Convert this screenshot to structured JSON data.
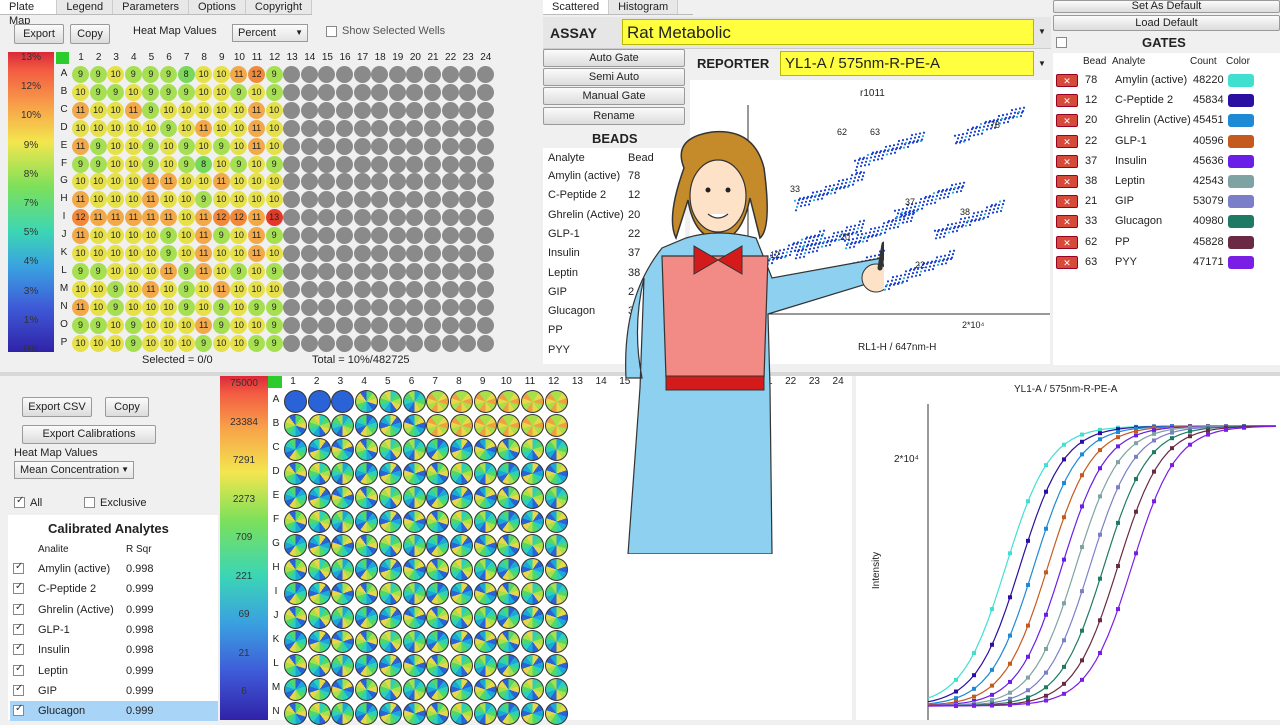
{
  "left_tabs": [
    "Plate Map",
    "Legend",
    "Parameters",
    "Options",
    "Copyright"
  ],
  "plate": {
    "export_label": "Export",
    "copy_label": "Copy",
    "heat_label": "Heat Map Values",
    "heat_value": "Percent",
    "show_selected_label": "Show Selected Wells",
    "scale": [
      "13%",
      "12%",
      "10%",
      "9%",
      "8%",
      "7%",
      "5%",
      "4%",
      "3%",
      "1%",
      "0%"
    ],
    "columns": [
      "1",
      "2",
      "3",
      "4",
      "5",
      "6",
      "7",
      "8",
      "9",
      "10",
      "11",
      "12",
      "13",
      "14",
      "15",
      "16",
      "17",
      "18",
      "19",
      "20",
      "21",
      "22",
      "23",
      "24"
    ],
    "rows": [
      "A",
      "B",
      "C",
      "D",
      "E",
      "F",
      "G",
      "H",
      "I",
      "J",
      "K",
      "L",
      "M",
      "N",
      "O",
      "P"
    ],
    "values": [
      [
        "9",
        "9",
        "10",
        "9",
        "9",
        "9",
        "8",
        "10",
        "10",
        "11",
        "12",
        "9"
      ],
      [
        "10",
        "9",
        "9",
        "10",
        "9",
        "9",
        "9",
        "10",
        "10",
        "9",
        "10",
        "9"
      ],
      [
        "11",
        "10",
        "10",
        "11",
        "9",
        "10",
        "10",
        "10",
        "10",
        "10",
        "11",
        "10"
      ],
      [
        "10",
        "10",
        "10",
        "10",
        "10",
        "9",
        "10",
        "11",
        "10",
        "10",
        "11",
        "10"
      ],
      [
        "11",
        "9",
        "10",
        "10",
        "9",
        "10",
        "9",
        "10",
        "9",
        "10",
        "11",
        "10"
      ],
      [
        "9",
        "9",
        "10",
        "10",
        "9",
        "10",
        "9",
        "8",
        "10",
        "9",
        "10",
        "9"
      ],
      [
        "10",
        "10",
        "10",
        "10",
        "11",
        "11",
        "10",
        "10",
        "11",
        "10",
        "10",
        "10"
      ],
      [
        "11",
        "10",
        "10",
        "10",
        "11",
        "10",
        "10",
        "9",
        "10",
        "10",
        "10",
        "10"
      ],
      [
        "12",
        "11",
        "11",
        "11",
        "11",
        "11",
        "10",
        "11",
        "12",
        "12",
        "11",
        "13"
      ],
      [
        "11",
        "10",
        "10",
        "10",
        "10",
        "9",
        "10",
        "11",
        "9",
        "10",
        "11",
        "9"
      ],
      [
        "10",
        "10",
        "10",
        "10",
        "10",
        "9",
        "10",
        "11",
        "10",
        "10",
        "11",
        "10"
      ],
      [
        "9",
        "9",
        "10",
        "10",
        "10",
        "11",
        "9",
        "11",
        "10",
        "9",
        "10",
        "9"
      ],
      [
        "10",
        "10",
        "9",
        "10",
        "11",
        "10",
        "9",
        "10",
        "11",
        "10",
        "10",
        "10"
      ],
      [
        "11",
        "10",
        "9",
        "10",
        "10",
        "10",
        "9",
        "10",
        "9",
        "10",
        "9",
        "9"
      ],
      [
        "9",
        "9",
        "10",
        "9",
        "10",
        "10",
        "10",
        "11",
        "9",
        "10",
        "10",
        "9"
      ],
      [
        "10",
        "10",
        "10",
        "9",
        "10",
        "10",
        "10",
        "9",
        "10",
        "10",
        "9",
        "9"
      ]
    ],
    "selected": "Selected = 0/0",
    "total": "Total = 10%/482725"
  },
  "mid_tabs": [
    "Scattered",
    "Histogram"
  ],
  "assay": {
    "label": "ASSAY",
    "value": "Rat Metabolic",
    "reporter_label": "REPORTER",
    "reporter_value": "YL1-A / 575nm-R-PE-A"
  },
  "gate_buttons": [
    "Auto Gate",
    "Semi Auto",
    "Manual Gate",
    "Rename"
  ],
  "beads": {
    "title": "BEADS",
    "headers": [
      "Analyte",
      "Bead"
    ],
    "rows": [
      [
        "Amylin (active)",
        "78"
      ],
      [
        "C-Peptide 2",
        "12"
      ],
      [
        "Ghrelin (Active)",
        "20"
      ],
      [
        "GLP-1",
        "22"
      ],
      [
        "Insulin",
        "37"
      ],
      [
        "Leptin",
        "38"
      ],
      [
        "GIP",
        "2"
      ],
      [
        "Glucagon",
        "3"
      ],
      [
        "PP",
        "6"
      ],
      [
        "PYY",
        "6"
      ]
    ]
  },
  "scatter": {
    "title": "r1011",
    "xlabel": "RL1-H / 647nm-H",
    "xtick": "2*10⁴",
    "labels": [
      "78",
      "62",
      "63",
      "37",
      "38",
      "20",
      "33",
      "12",
      "22"
    ]
  },
  "right_top": {
    "set_default": "Set As Default",
    "load_default": "Load Default",
    "gates_title": "GATES",
    "headers": [
      "Bead",
      "Analyte",
      "Count",
      "Color"
    ],
    "rows": [
      {
        "bead": "78",
        "analyte": "Amylin (active)",
        "count": "48220",
        "color": "#40e0d0"
      },
      {
        "bead": "12",
        "analyte": "C-Peptide 2",
        "count": "45834",
        "color": "#2a0fa0"
      },
      {
        "bead": "20",
        "analyte": "Ghrelin (Active)",
        "count": "45451",
        "color": "#1e8ad6"
      },
      {
        "bead": "22",
        "analyte": "GLP-1",
        "count": "40596",
        "color": "#c45a1e"
      },
      {
        "bead": "37",
        "analyte": "Insulin",
        "count": "45636",
        "color": "#6a1fe6"
      },
      {
        "bead": "38",
        "analyte": "Leptin",
        "count": "42543",
        "color": "#7fa3a3"
      },
      {
        "bead": "21",
        "analyte": "GIP",
        "count": "53079",
        "color": "#7a7fc8"
      },
      {
        "bead": "33",
        "analyte": "Glucagon",
        "count": "40980",
        "color": "#1e7a64"
      },
      {
        "bead": "62",
        "analyte": "PP",
        "count": "45828",
        "color": "#6a2a44"
      },
      {
        "bead": "63",
        "analyte": "PYY",
        "count": "47171",
        "color": "#7a1ee6"
      }
    ]
  },
  "bottom_left": {
    "export_csv": "Export CSV",
    "copy": "Copy",
    "export_cal": "Export Calibrations",
    "heat_label": "Heat Map Values",
    "heat_value": "Mean Concentration",
    "all_label": "All",
    "exclusive_label": "Exclusive",
    "cal_title": "Calibrated Analytes",
    "headers": [
      "Analite",
      "R Sqr"
    ],
    "rows": [
      [
        "Amylin (active)",
        "0.998"
      ],
      [
        "C-Peptide 2",
        "0.999"
      ],
      [
        "Ghrelin (Active)",
        "0.999"
      ],
      [
        "GLP-1",
        "0.998"
      ],
      [
        "Insulin",
        "0.998"
      ],
      [
        "Leptin",
        "0.999"
      ],
      [
        "GIP",
        "0.999"
      ],
      [
        "Glucagon",
        "0.999"
      ]
    ]
  },
  "bottom_plate": {
    "scale": [
      "75000",
      "23384",
      "7291",
      "2273",
      "709",
      "221",
      "69",
      "21",
      "6"
    ],
    "columns": [
      "1",
      "2",
      "3",
      "4",
      "5",
      "6",
      "7",
      "8",
      "9",
      "10",
      "11",
      "12",
      "13",
      "14",
      "15",
      "16",
      "17",
      "18",
      "19",
      "20",
      "21",
      "22",
      "23",
      "24"
    ],
    "rows": [
      "A",
      "B",
      "C",
      "D",
      "E",
      "F",
      "G",
      "H",
      "I",
      "J",
      "K",
      "L",
      "M",
      "N"
    ]
  },
  "curve": {
    "title": "YL1-A / 575nm-R-PE-A",
    "ylabel": "Intensity",
    "ytick": "2*10⁴"
  }
}
